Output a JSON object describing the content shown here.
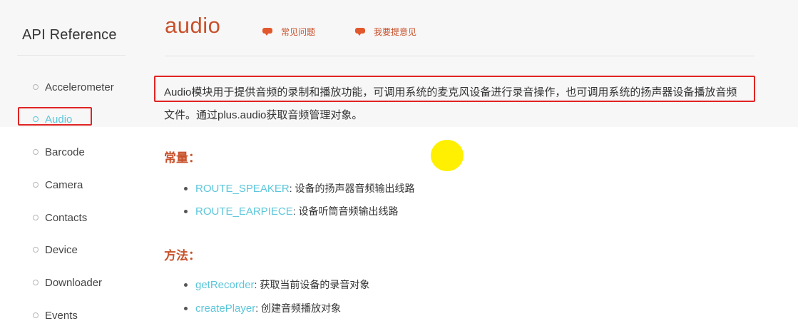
{
  "sidebar": {
    "title": "API Reference",
    "items": [
      {
        "label": "Accelerometer",
        "active": false
      },
      {
        "label": "Audio",
        "active": true
      },
      {
        "label": "Barcode",
        "active": false
      },
      {
        "label": "Camera",
        "active": false
      },
      {
        "label": "Contacts",
        "active": false
      },
      {
        "label": "Device",
        "active": false
      },
      {
        "label": "Downloader",
        "active": false
      },
      {
        "label": "Events",
        "active": false
      }
    ]
  },
  "header": {
    "title": "audio",
    "links": [
      {
        "label": "常见问题",
        "icon": "comment-icon"
      },
      {
        "label": "我要提意见",
        "icon": "comment-icon"
      }
    ]
  },
  "description": {
    "line1": "Audio模块用于提供音频的录制和播放功能，可调用系统的麦克风设备进行录音操作，也可调用系统的扬声器设备播放音频",
    "line2": "文件。通过plus.audio获取音频管理对象。"
  },
  "sections": [
    {
      "heading": "常量：",
      "items": [
        {
          "name": "ROUTE_SPEAKER",
          "desc": ": 设备的扬声器音频输出线路"
        },
        {
          "name": "ROUTE_EARPIECE",
          "desc": ": 设备听筒音频输出线路"
        }
      ]
    },
    {
      "heading": "方法：",
      "items": [
        {
          "name": "getRecorder",
          "desc": ": 获取当前设备的录音对象"
        },
        {
          "name": "createPlayer",
          "desc": ": 创建音频播放对象"
        }
      ]
    }
  ],
  "colors": {
    "accent": "#c8512b",
    "link": "#5bc6da",
    "highlight_box": "#e02424",
    "cursor": "#ffef00"
  }
}
